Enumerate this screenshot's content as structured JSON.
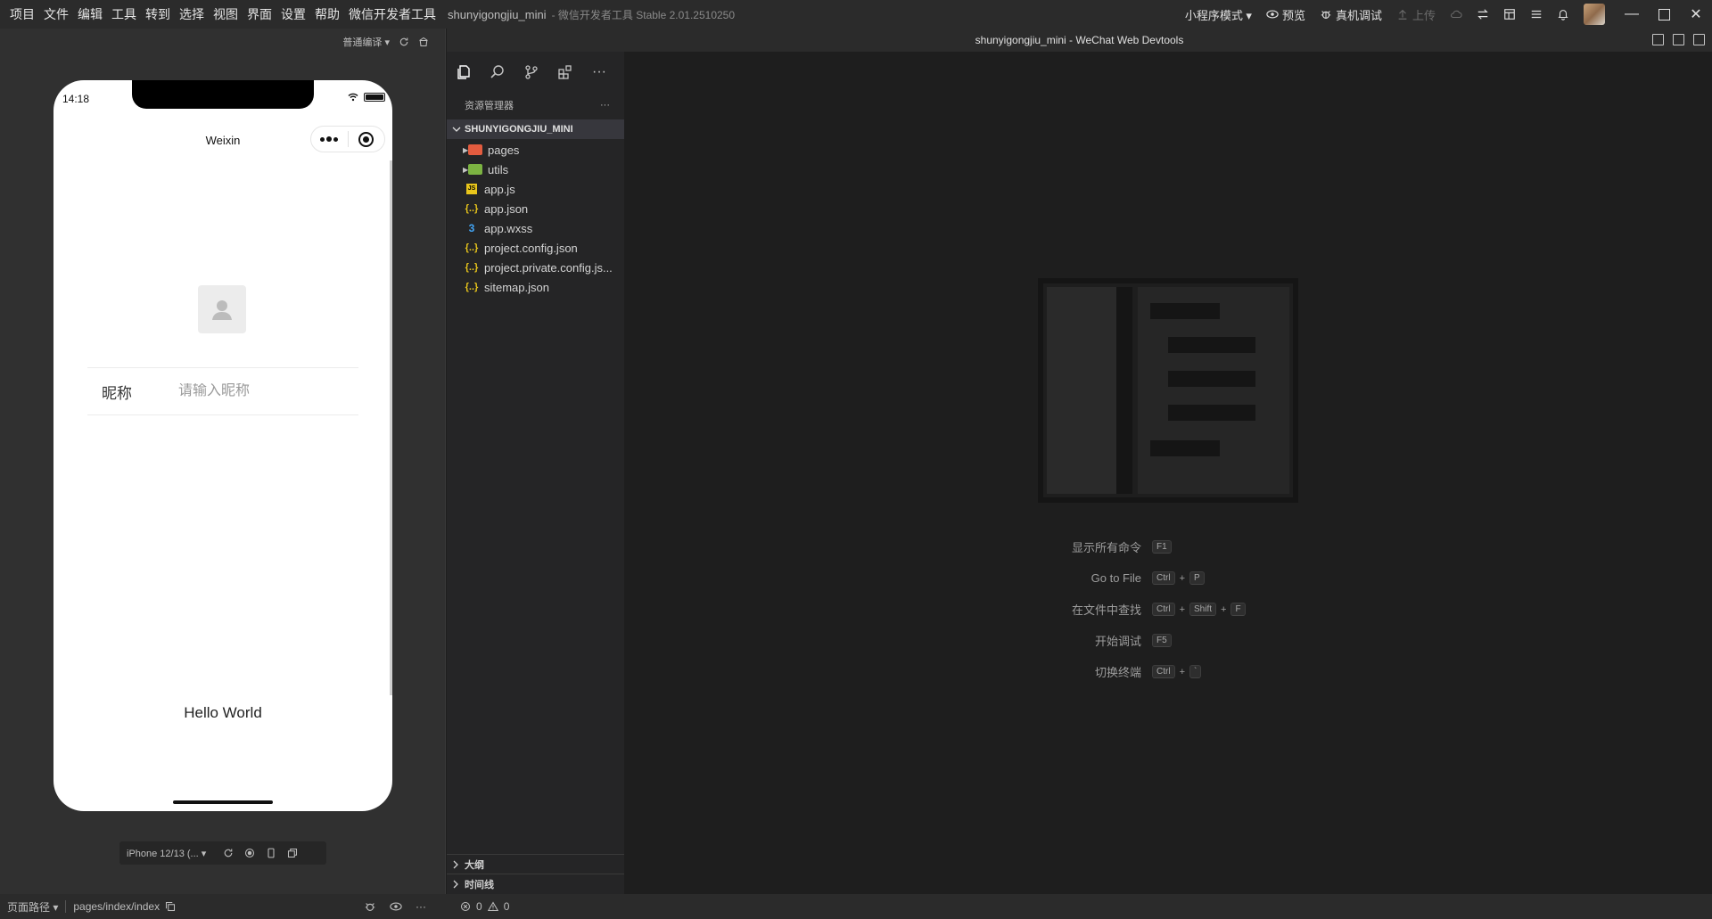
{
  "menu": [
    "项目",
    "文件",
    "编辑",
    "工具",
    "转到",
    "选择",
    "视图",
    "界面",
    "设置",
    "帮助",
    "微信开发者工具"
  ],
  "title": {
    "project": "shunyigongjiu_mini",
    "app": "- 微信开发者工具 Stable 2.01.2510250"
  },
  "toolbar": {
    "mode": "小程序模式 ▾",
    "preview": "预览",
    "real_debug": "真机调试",
    "upload": "上传"
  },
  "simulator": {
    "compile_mode": "普通编译 ▾",
    "status_time": "14:18",
    "nav_title": "Weixin",
    "nickname_label": "昵称",
    "nickname_placeholder": "请输入昵称",
    "hello": "Hello World",
    "device": "iPhone 12/13 (... ▾"
  },
  "statusbar": {
    "path_label": "页面路径 ▾",
    "path": "pages/index/index",
    "errors": "0",
    "warnings": "0"
  },
  "explorer": {
    "header": "资源管理器",
    "project": "SHUNYIGONGJIU_MINI",
    "items": [
      {
        "name": "pages",
        "type": "folder-red"
      },
      {
        "name": "utils",
        "type": "folder-green"
      },
      {
        "name": "app.js",
        "type": "js"
      },
      {
        "name": "app.json",
        "type": "json"
      },
      {
        "name": "app.wxss",
        "type": "css"
      },
      {
        "name": "project.config.json",
        "type": "json"
      },
      {
        "name": "project.private.config.js...",
        "type": "json"
      },
      {
        "name": "sitemap.json",
        "type": "json"
      }
    ],
    "outline": "大纲",
    "timeline": "时间线"
  },
  "editor": {
    "window_title": "shunyigongjiu_mini - WeChat Web Devtools",
    "shortcuts": [
      {
        "label": "显示所有命令",
        "keys": [
          "F1"
        ]
      },
      {
        "label": "Go to File",
        "keys": [
          "Ctrl",
          "P"
        ]
      },
      {
        "label": "在文件中查找",
        "keys": [
          "Ctrl",
          "Shift",
          "F"
        ]
      },
      {
        "label": "开始调试",
        "keys": [
          "F5"
        ]
      },
      {
        "label": "切换终端",
        "keys": [
          "Ctrl",
          "`"
        ]
      }
    ]
  },
  "colors": {
    "accent_folder_pages": "#e35c3f",
    "accent_folder_utils": "#7cb342",
    "json_icon": "#e8c51b",
    "css_icon": "#42a5f5"
  }
}
